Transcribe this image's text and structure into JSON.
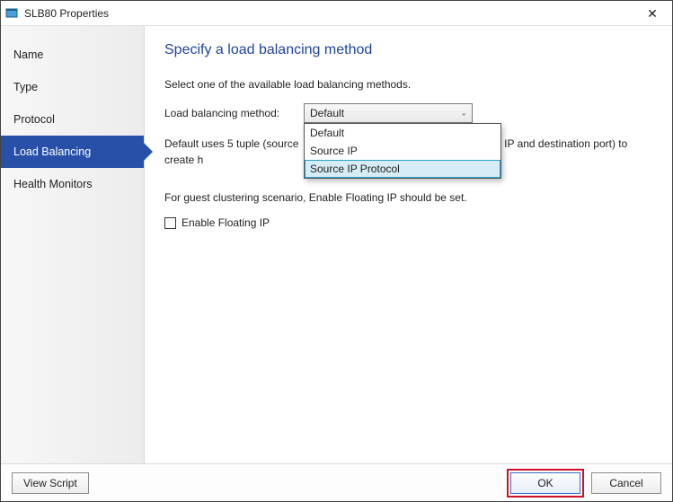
{
  "window": {
    "title": "SLB80 Properties"
  },
  "sidebar": {
    "items": [
      {
        "label": "Name",
        "active": false
      },
      {
        "label": "Type",
        "active": false
      },
      {
        "label": "Protocol",
        "active": false
      },
      {
        "label": "Load Balancing",
        "active": true
      },
      {
        "label": "Health Monitors",
        "active": false
      }
    ]
  },
  "page": {
    "title": "Specify a load balancing method",
    "intro": "Select one of the available load balancing methods.",
    "method_label": "Load balancing method:",
    "method_selected": "Default",
    "method_options": [
      "Default",
      "Source IP",
      "Source IP Protocol"
    ],
    "method_hover_index": 2,
    "desc_fragment_pre": "Default uses 5 tuple (source",
    "desc_fragment_post": "IP and destination port) to create h",
    "floating_note": "For guest clustering scenario, Enable Floating IP should be set.",
    "floating_checkbox_label": "Enable Floating IP",
    "floating_checked": false
  },
  "footer": {
    "view_script": "View Script",
    "ok": "OK",
    "cancel": "Cancel"
  }
}
